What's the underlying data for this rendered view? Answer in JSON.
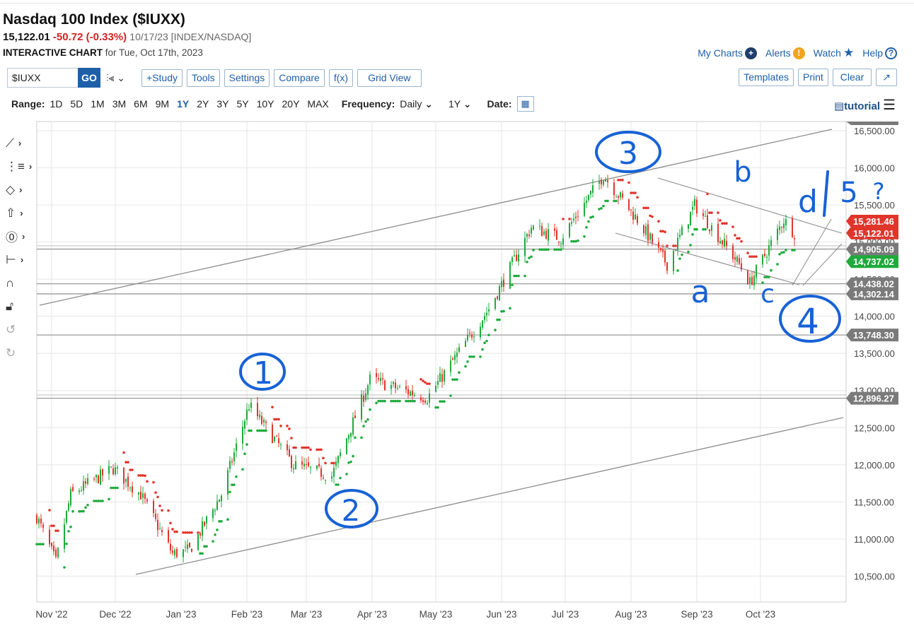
{
  "header": {
    "title": "Nasdaq 100 Index ($IUXX)",
    "last": "15,122.01",
    "change": "-50.72 (-0.33%)",
    "meta": "10/17/23 [INDEX/NASDAQ]",
    "interactive_bold": "INTERACTIVE CHART",
    "interactive_rest": "for Tue, Oct 17th, 2023"
  },
  "toplinks": {
    "my_charts": "My Charts",
    "alerts": "Alerts",
    "watch": "Watch",
    "help": "Help"
  },
  "toolbar": {
    "symbol": "$IUXX",
    "go": "GO",
    "study": "+Study",
    "tools": "Tools",
    "settings": "Settings",
    "compare": "Compare",
    "fx": "f(x)",
    "gridview": "Grid View",
    "templates": "Templates",
    "print": "Print",
    "clear": "Clear",
    "popout": "↗"
  },
  "rangebar": {
    "range_label": "Range:",
    "ranges": [
      "1D",
      "5D",
      "1M",
      "3M",
      "6M",
      "9M",
      "1Y",
      "2Y",
      "3Y",
      "5Y",
      "10Y",
      "20Y",
      "MAX"
    ],
    "active_range": "1Y",
    "frequency_label": "Frequency:",
    "frequency": "Daily",
    "period": "1Y",
    "date_label": "Date:",
    "tutorial": "tutorial"
  },
  "colors": {
    "accent": "#1f5fa8",
    "up": "#1faa3c",
    "down": "#e0352b",
    "grey_tag": "#7a7a7a"
  },
  "chart_data": {
    "type": "candlestick",
    "x_ticks": [
      "Nov '22",
      "Dec '22",
      "Jan '23",
      "Feb '23",
      "Mar '23",
      "Apr '23",
      "May '23",
      "Jun '23",
      "Jul '23",
      "Aug '23",
      "Sep '23",
      "Oct '23"
    ],
    "y_ticks": [
      "16,500.00",
      "16,000.00",
      "15,500.00",
      "15,000.00",
      "14,500.00",
      "14,000.00",
      "13,500.00",
      "13,000.00",
      "12,500.00",
      "12,000.00",
      "11,500.00",
      "11,000.00",
      "10,500.00"
    ],
    "ylim": [
      10150,
      16650
    ],
    "grid": true,
    "closes": [
      {
        "date": "2022-10-25",
        "close": 11300
      },
      {
        "date": "2022-11-03",
        "close": 10690
      },
      {
        "date": "2022-11-10",
        "close": 11600
      },
      {
        "date": "2022-11-30",
        "close": 11950
      },
      {
        "date": "2022-12-13",
        "close": 11600
      },
      {
        "date": "2022-12-28",
        "close": 10800
      },
      {
        "date": "2023-01-05",
        "close": 10850
      },
      {
        "date": "2023-01-20",
        "close": 11600
      },
      {
        "date": "2023-02-02",
        "close": 12800
      },
      {
        "date": "2023-02-23",
        "close": 12000
      },
      {
        "date": "2023-03-13",
        "close": 11850
      },
      {
        "date": "2023-03-31",
        "close": 13150
      },
      {
        "date": "2023-04-27",
        "close": 12900
      },
      {
        "date": "2023-05-26",
        "close": 14100
      },
      {
        "date": "2023-06-15",
        "close": 15200
      },
      {
        "date": "2023-06-29",
        "close": 15050
      },
      {
        "date": "2023-07-19",
        "close": 15900
      },
      {
        "date": "2023-08-04",
        "close": 15300
      },
      {
        "date": "2023-08-18",
        "close": 14700
      },
      {
        "date": "2023-08-31",
        "close": 15500
      },
      {
        "date": "2023-09-21",
        "close": 14700
      },
      {
        "date": "2023-09-26",
        "close": 14450
      },
      {
        "date": "2023-10-12",
        "close": 15300
      },
      {
        "date": "2023-10-17",
        "close": 15122
      }
    ],
    "price_tags": [
      {
        "value": 15281.46,
        "label": "15,281.46",
        "color": "#e0352b"
      },
      {
        "value": 15122.01,
        "label": "15,122.01",
        "color": "#e0352b"
      },
      {
        "value": 14905.09,
        "label": "14,905.09",
        "color": "#7a7a7a"
      },
      {
        "value": 14737.02,
        "label": "14,737.02",
        "color": "#1faa3c"
      },
      {
        "value": 14438.02,
        "label": "14,438.02",
        "color": "#7a7a7a"
      },
      {
        "value": 14302.14,
        "label": "14,302.14",
        "color": "#7a7a7a"
      },
      {
        "value": 13748.3,
        "label": "13,748.30",
        "color": "#7a7a7a"
      },
      {
        "value": 12896.27,
        "label": "12,896.27",
        "color": "#7a7a7a"
      }
    ],
    "annotations": [
      "1",
      "2",
      "3",
      "4",
      "a",
      "b",
      "c",
      "d",
      "5",
      "?"
    ]
  }
}
